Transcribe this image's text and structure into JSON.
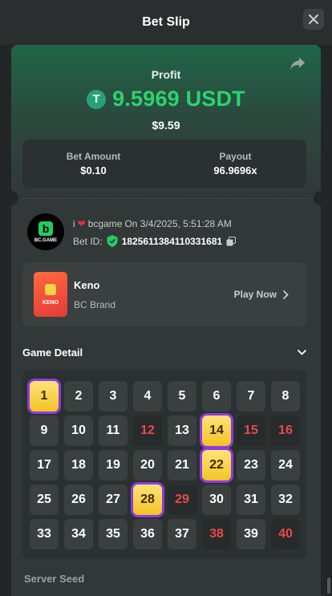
{
  "header": {
    "title": "Bet Slip"
  },
  "profit": {
    "label": "Profit",
    "value": "9.5969 USDT",
    "usd": "$9.59",
    "currency_symbol": "T"
  },
  "bet": {
    "amount_label": "Bet Amount",
    "amount": "$0.10",
    "payout_label": "Payout",
    "payout": "96.9696x"
  },
  "user": {
    "prefix": "i",
    "name": "bcgame",
    "date": "On 3/4/2025, 5:51:28 AM",
    "bet_id_label": "Bet ID:",
    "bet_id": "182561138411033168​1",
    "logo_text": "BC.GAME"
  },
  "game": {
    "name": "Keno",
    "brand": "BC Brand",
    "play": "Play Now",
    "thumb_text": "KENO"
  },
  "detail": {
    "title": "Game Detail"
  },
  "grid": {
    "cells": [
      {
        "n": "1",
        "s": "hit"
      },
      {
        "n": "2",
        "s": "normal"
      },
      {
        "n": "3",
        "s": "normal"
      },
      {
        "n": "4",
        "s": "normal"
      },
      {
        "n": "5",
        "s": "normal"
      },
      {
        "n": "6",
        "s": "normal"
      },
      {
        "n": "7",
        "s": "normal"
      },
      {
        "n": "8",
        "s": "normal"
      },
      {
        "n": "9",
        "s": "normal"
      },
      {
        "n": "10",
        "s": "normal"
      },
      {
        "n": "11",
        "s": "normal"
      },
      {
        "n": "12",
        "s": "miss"
      },
      {
        "n": "13",
        "s": "normal"
      },
      {
        "n": "14",
        "s": "hit"
      },
      {
        "n": "15",
        "s": "miss"
      },
      {
        "n": "16",
        "s": "miss"
      },
      {
        "n": "17",
        "s": "normal"
      },
      {
        "n": "18",
        "s": "normal"
      },
      {
        "n": "19",
        "s": "normal"
      },
      {
        "n": "20",
        "s": "normal"
      },
      {
        "n": "21",
        "s": "normal"
      },
      {
        "n": "22",
        "s": "hit"
      },
      {
        "n": "23",
        "s": "normal"
      },
      {
        "n": "24",
        "s": "normal"
      },
      {
        "n": "25",
        "s": "normal"
      },
      {
        "n": "26",
        "s": "normal"
      },
      {
        "n": "27",
        "s": "normal"
      },
      {
        "n": "28",
        "s": "hit"
      },
      {
        "n": "29",
        "s": "miss"
      },
      {
        "n": "30",
        "s": "normal"
      },
      {
        "n": "31",
        "s": "normal"
      },
      {
        "n": "32",
        "s": "normal"
      },
      {
        "n": "33",
        "s": "normal"
      },
      {
        "n": "34",
        "s": "normal"
      },
      {
        "n": "35",
        "s": "normal"
      },
      {
        "n": "36",
        "s": "normal"
      },
      {
        "n": "37",
        "s": "normal"
      },
      {
        "n": "38",
        "s": "miss"
      },
      {
        "n": "39",
        "s": "normal"
      },
      {
        "n": "40",
        "s": "miss"
      }
    ]
  },
  "server_seed": {
    "label": "Server Seed"
  },
  "colors": {
    "accent_green": "#29d56e",
    "hit_gold": "#f3c424",
    "hit_ring": "#8c3be0",
    "miss_red": "#e84a4a"
  }
}
